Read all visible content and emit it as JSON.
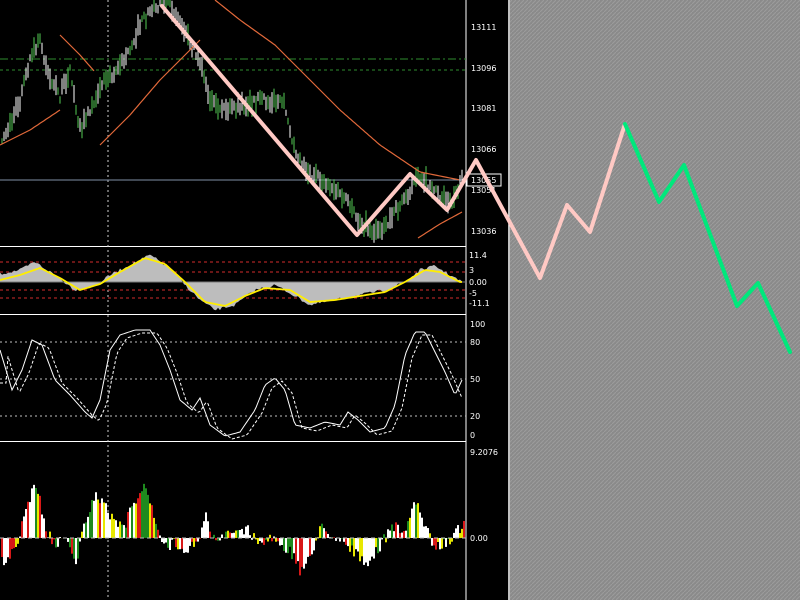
{
  "colors": {
    "background": "#000000",
    "right_panel": "#8c8c8c",
    "separator": "#ffffff",
    "zigzag_pink": "#ffc9c4",
    "zigzag_green": "#00e87c",
    "ma_line": "#e2693a",
    "price_bar_up": "#ffffff",
    "price_bar_down": "#55cc55",
    "guide_green": "#2e8b2e",
    "macd_hist": "#bdbdbd",
    "macd_signal": "#ffee00",
    "macd_level": "#d22b2b",
    "stoch_line": "#ffffff",
    "hist_white": "#ffffff",
    "hist_red": "#d81818",
    "hist_green": "#1e8a1e",
    "hist_yellow": "#e8e800"
  },
  "chart_data": [
    {
      "type": "line",
      "panel": "price",
      "y_ticks": [
        "13111",
        "13096",
        "13081",
        "13066",
        "13051",
        "13036"
      ],
      "y_tick_values": [
        13111,
        13096,
        13081,
        13066,
        13051,
        13036
      ],
      "current_price_label": "13055",
      "current_price": 13055,
      "ylim": [
        13030,
        13120
      ],
      "grid": false
    },
    {
      "type": "line",
      "panel": "macd",
      "y_ticks": [
        "11.4",
        "3",
        "0.00",
        "-5",
        "-11.1"
      ],
      "ylim": [
        -14,
        14
      ]
    },
    {
      "type": "line",
      "panel": "stochastic",
      "y_ticks": [
        "100",
        "80",
        "50",
        "20",
        "0"
      ],
      "levels": [
        80,
        50,
        20
      ],
      "ylim": [
        0,
        100
      ]
    },
    {
      "type": "bar",
      "panel": "histogram",
      "y_ticks": [
        "9.2076",
        "0.00"
      ],
      "ylim": [
        -9.2076,
        9.2076
      ]
    }
  ]
}
